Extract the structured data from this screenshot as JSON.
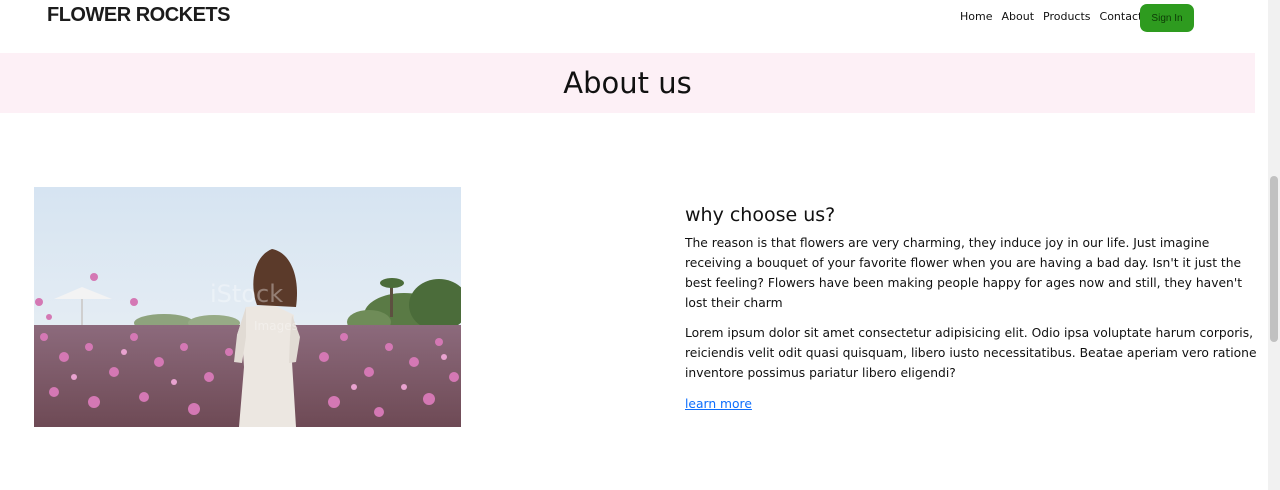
{
  "nav": {
    "brand": "FLOWER ROCKETS",
    "links": [
      "Home",
      "About",
      "Products",
      "Contact"
    ],
    "signin_label": "Sign In"
  },
  "banner": {
    "title": "About us"
  },
  "photo": {
    "watermark": "iStock",
    "watermark_sub": "Images"
  },
  "section": {
    "heading": "why choose us?",
    "paragraph1": "The reason is that flowers are very charming, they induce joy in our life. Just imagine receiving a bouquet of your favorite flower when you are having a bad day. Isn't it just the best feeling? Flowers have been making people happy for ages now and still, they haven't lost their charm",
    "paragraph2": "Lorem ipsum dolor sit amet consectetur adipisicing elit. Odio ipsa voluptate harum corporis, reiciendis velit odit quasi quisquam, libero iusto necessitatibus. Beatae aperiam vero ratione inventore possimus pariatur libero eligendi?",
    "link": "learn more"
  },
  "colors": {
    "accent": "#2e9b1f",
    "banner_bg": "#fdf0f6",
    "link": "#0d6efd"
  }
}
